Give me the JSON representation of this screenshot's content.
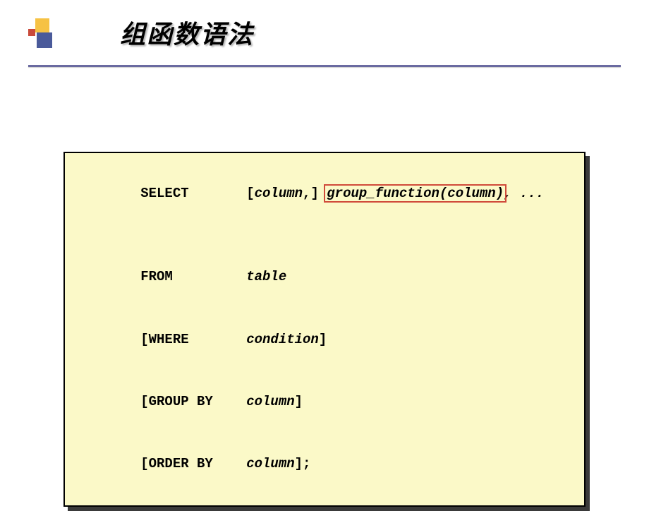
{
  "slide": {
    "title": "组函数语法"
  },
  "code": {
    "line1": {
      "keyword": "SELECT",
      "prefix": "[",
      "arg1": "column",
      "mid": ",] ",
      "highlight": "group_function(column)",
      "suffix": ", ..."
    },
    "line2": {
      "keyword": "FROM",
      "arg": "table"
    },
    "line3": {
      "keyword": "[WHERE",
      "arg": "condition",
      "suffix": "]"
    },
    "line4": {
      "keyword": "[GROUP BY",
      "arg": "column",
      "suffix": "]"
    },
    "line5": {
      "keyword": "[ORDER BY",
      "arg": "column",
      "suffix": "];"
    }
  }
}
